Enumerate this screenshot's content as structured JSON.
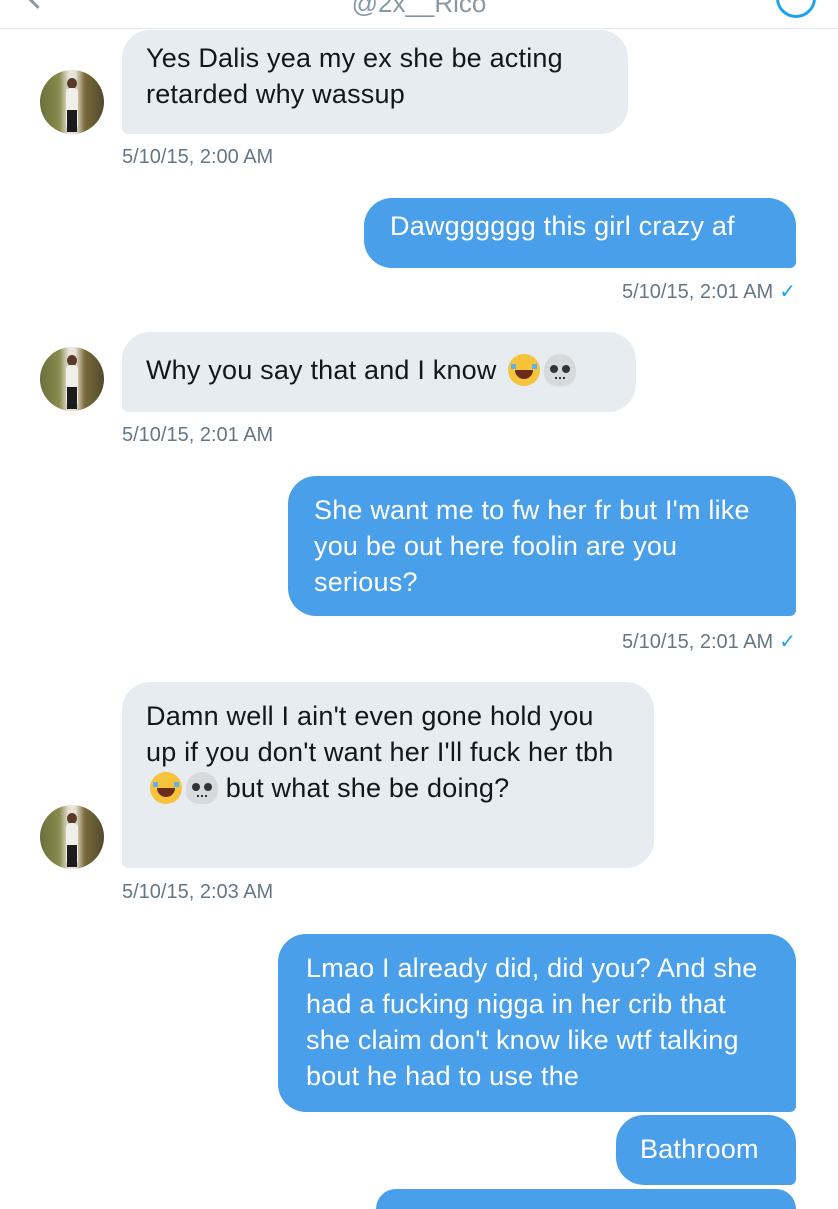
{
  "header": {
    "handle": "@2x__Rico"
  },
  "messages": [
    {
      "side": "in",
      "text": "Yes Dalis yea my ex she be acting retarded why wassup",
      "timestamp": "5/10/15, 2:00 AM"
    },
    {
      "side": "out",
      "text": "Dawgggggg this girl crazy af",
      "timestamp": "5/10/15, 2:01 AM"
    },
    {
      "side": "in",
      "text": "Why you say that and I know",
      "emoji": [
        "face-with-tears-of-joy",
        "skull"
      ],
      "timestamp": "5/10/15, 2:01 AM"
    },
    {
      "side": "out",
      "text": "She want me to fw her fr but I'm like you be out here foolin are you serious?",
      "timestamp": "5/10/15, 2:01 AM"
    },
    {
      "side": "in",
      "text_a": "Damn well I ain't even gone hold you up if you don't want her I'll fuck her tbh",
      "emoji": [
        "face-with-tears-of-joy",
        "skull"
      ],
      "text_b": "but what she be doing?",
      "timestamp": "5/10/15, 2:03 AM"
    },
    {
      "side": "out",
      "text": "Lmao I already did, did you? And she had a fucking nigga in her crib that she claim don't know like wtf talking bout he had to use the"
    },
    {
      "side": "out",
      "text": "Bathroom"
    }
  ],
  "read_check": "✓",
  "colors": {
    "incoming_bubble": "#e6ecf0",
    "outgoing_bubble": "#4a9fea",
    "timestamp": "#657786",
    "accent": "#1da1f2"
  }
}
